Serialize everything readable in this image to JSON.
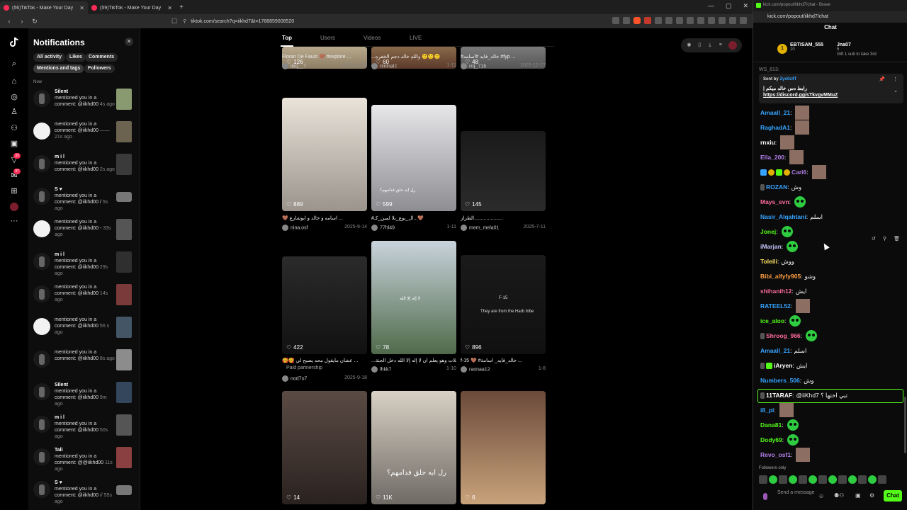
{
  "browser": {
    "tabs": [
      {
        "label": "(56)TikTok - Make Your Day",
        "active": true
      },
      {
        "label": "(59)TikTok - Make Your Day",
        "active": false
      }
    ],
    "url": "tiktok.com/search?q=iikhd7&t=1768859008520"
  },
  "rail": {
    "badge_1": "33",
    "badge_2": "37",
    "avatar_text": "M"
  },
  "notifications": {
    "title": "Notifications",
    "filters": [
      "All activity",
      "Likes",
      "Comments",
      "Mentions and tags",
      "Followers"
    ],
    "selected_filter": "Mentions and tags",
    "section": "Now",
    "items": [
      {
        "name": "Silent",
        "text": "mentioned you in a comment: @iikhd00",
        "time": "4s ago"
      },
      {
        "name": "",
        "text": "mentioned you in a comment: @iikhd00",
        "time": "—— 21s ago"
      },
      {
        "name": "m i l",
        "text": "mentioned you in a comment: @iikhd00",
        "time": "2s ago"
      },
      {
        "name": "S ♥",
        "text": "mentioned you in a comment: @iikhd00 /",
        "time": "5s ago"
      },
      {
        "name": "",
        "text": "mentioned you in a comment: @iikhd00 -",
        "time": "33s ago"
      },
      {
        "name": "m i l",
        "text": "mentioned you in a comment: @iikhd00",
        "time": "29s ago"
      },
      {
        "name": "",
        "text": "mentioned you in a comment: @iikhd00",
        "time": "14s ago"
      },
      {
        "name": "",
        "text": "mentioned you in a comment: @iikhd00",
        "time": "56 s ago"
      },
      {
        "name": "",
        "text": "mentioned you in a comment: @iikhd00",
        "time": "8s ago"
      },
      {
        "name": "Silent",
        "text": "mentioned you in a comment: @iikhd00",
        "time": "9m ago"
      },
      {
        "name": "m i l",
        "text": "mentioned you in a comment: @iikhd00",
        "time": "50s ago"
      },
      {
        "name": "Tali",
        "text": "mentioned you in a comment: @@iikhd00",
        "time": "11s ago"
      },
      {
        "name": "S ♥",
        "text": "mentioned you in a comment: @iikhd00",
        "time": "// 55s ago"
      }
    ]
  },
  "search": {
    "tabs": [
      "Top",
      "Users",
      "Videos",
      "LIVE"
    ],
    "active_tab": "Top",
    "cards": [
      {
        "likes": "126",
        "caption": "Floran De Faust 🤎 #explore ...",
        "user": "iikq__7",
        "date": "2025-10-26"
      },
      {
        "likes": "60",
        "caption": "...واللهِ خالد دجم الخفره 🙂🙂🙂",
        "user": "nlnlnal.l",
        "date": "1-11"
      },
      {
        "likes": "48",
        "caption": "#خالد_قايد #أسامه #fyp ...",
        "user": "rrq_716",
        "date": "2025-12-27"
      },
      {
        "likes": "889",
        "caption": "🤎 اسامه و خالد و ابوشارع ...",
        "user": "nina.osf",
        "date": "2025-9-14"
      },
      {
        "likes": "599",
        "caption": "#ال_يوع_بلا لمين_كـ...🤎",
        "user": "77hl49",
        "date": "1-11"
      },
      {
        "likes": "145",
        "caption": "الطراز.....................",
        "user": "mem_mela01",
        "date": "2025-7-11"
      },
      {
        "likes": "422",
        "caption": "🥰🥰 عشان مايقول محد يصيح لي ...",
        "user": "nod7o7",
        "date": "2025-9-18",
        "paid": "Paid partnership"
      },
      {
        "likes": "78",
        "caption": "...معلات وهو يعلم ان لا إله إلا الله دخل الجنة",
        "user": "lhkk7",
        "date": "1-10"
      },
      {
        "likes": "896",
        "caption": "f-15 🤎 #خالد_قايد_ اسامة ...",
        "user": "raonaa12",
        "date": "1-8"
      },
      {
        "likes": "14",
        "caption": "",
        "user": "",
        "date": ""
      },
      {
        "likes": "11K",
        "caption": "",
        "user": "",
        "date": ""
      },
      {
        "likes": "6",
        "caption": "",
        "user": "",
        "date": ""
      }
    ],
    "overlays": {
      "card4": "رل ابه حلق فدامهم؟",
      "card7": "لا إله إلا الله",
      "card8": "They are from the Harb tribe",
      "card8_top": "F-15"
    }
  },
  "chat_window": {
    "title_bar": "kick.com/popout/iikhd7/chat - Brave",
    "url": "kick.com/popout/iikhd7/chat",
    "chat_title": "Chat",
    "top_gifters": [
      {
        "name": "EBTISAM_555",
        "count": "10"
      },
      {
        "name": "Jna07",
        "count": "5"
      }
    ],
    "gift_prompt": "Gift 1 sub to take 3rd",
    "pinned": {
      "sent_by": "Sent by",
      "author": "Zyo0z4T",
      "text": "| رابط دس خالد ميكم",
      "link": "https://discord.gg/sTkvgvMMuZ"
    },
    "cutoff_name": "WS_813:",
    "messages": [
      {
        "user": "Amaall_21",
        "color": "#36a3ff",
        "text": "",
        "extra": "pic"
      },
      {
        "user": "RaghadA1",
        "color": "#36a3ff",
        "text": "",
        "extra": "pic"
      },
      {
        "user": "rnxiu",
        "color": "#ffffff",
        "text": "",
        "extra": "pic"
      },
      {
        "user": "Ella_200",
        "color": "#b37feb",
        "text": "",
        "extra": "pic"
      },
      {
        "user": "Cari6",
        "color": "#b37feb",
        "text": "",
        "extra": "pic"
      },
      {
        "user": "ROZAN",
        "color": "#36a3ff",
        "text": "وش",
        "extra": ""
      },
      {
        "user": "Mays_svn",
        "color": "#ff6b9a",
        "text": "",
        "extra": "emote"
      },
      {
        "user": "Nasir_Alqahtani",
        "color": "#36a3ff",
        "text": "اسلم",
        "extra": ""
      },
      {
        "user": "Jonej",
        "color": "#53fc18",
        "text": "",
        "extra": "emote"
      },
      {
        "user": "iMarjan",
        "color": "#c8c8ff",
        "text": "",
        "extra": "emote"
      },
      {
        "user": "Toleili",
        "color": "#ffe066",
        "text": "ووش",
        "extra": ""
      },
      {
        "user": "Bibi_alfyfy905",
        "color": "#ff9f43",
        "text": "وشو",
        "extra": ""
      },
      {
        "user": "shihanih12",
        "color": "#ff6b9a",
        "text": "ايش",
        "extra": ""
      },
      {
        "user": "RATEEL52",
        "color": "#36a3ff",
        "text": "",
        "extra": "pic"
      },
      {
        "user": "ice_aloo",
        "color": "#53fc18",
        "text": "",
        "extra": "emote"
      },
      {
        "user": "Shroog_966",
        "color": "#ff6b9a",
        "text": "",
        "extra": "emote"
      },
      {
        "user": "Amaall_21",
        "color": "#36a3ff",
        "text": "اسلم",
        "extra": ""
      },
      {
        "user": "iAryen",
        "color": "#ffffff",
        "text": "ايش",
        "extra": ""
      },
      {
        "user": "Numbers_506",
        "color": "#36a3ff",
        "text": "وش",
        "extra": ""
      },
      {
        "user": "11TARAF",
        "color": "#ffffff",
        "text": "@iiKhd7 تبي اختها ؟",
        "extra": ""
      },
      {
        "user": "i8_pi",
        "color": "#36a3ff",
        "text": "",
        "extra": "pic"
      },
      {
        "user": "Dana81",
        "color": "#53fc18",
        "text": "",
        "extra": "emote"
      },
      {
        "user": "Dody69",
        "color": "#53fc18",
        "text": "",
        "extra": "emote"
      },
      {
        "user": "Revo_osf1",
        "color": "#b37feb",
        "text": "",
        "extra": "pic"
      }
    ],
    "followers_only": "Followers only",
    "input_placeholder": "Send a message",
    "send_label": "Chat"
  }
}
